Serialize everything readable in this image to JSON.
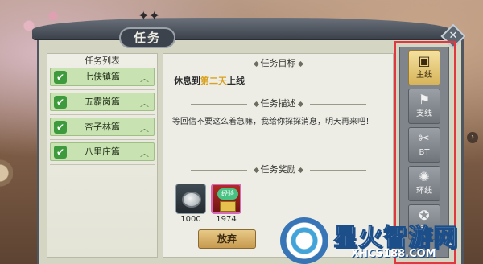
{
  "window": {
    "title": "任务",
    "close_label": "✕"
  },
  "task_list": {
    "title": "任务列表",
    "items": [
      {
        "label": "七侠镇篇",
        "checked": true
      },
      {
        "label": "五霸岗篇",
        "checked": true
      },
      {
        "label": "杏子林篇",
        "checked": true
      },
      {
        "label": "八里庄篇",
        "checked": true
      }
    ]
  },
  "detail": {
    "goal_heading": "任务目标",
    "goal_prefix": "休息到",
    "goal_highlight": "第二天",
    "goal_suffix": "上线",
    "desc_heading": "任务描述",
    "description": "等回信不要这么着急嘛，我给你探探消息，明天再来吧！",
    "reward_heading": "任务奖励",
    "rewards": [
      {
        "icon": "silver-coin-icon",
        "amount": "1000"
      },
      {
        "icon": "exp-gift-icon",
        "amount": "1974",
        "badge": "经验"
      }
    ],
    "abandon_button": "放弃"
  },
  "tabs": [
    {
      "label": "主线",
      "icon": "main-quest-icon",
      "active": true
    },
    {
      "label": "支线",
      "icon": "side-quest-icon",
      "active": false
    },
    {
      "label": "BT",
      "icon": "bt-quest-icon",
      "active": false
    },
    {
      "label": "环线",
      "icon": "loop-quest-icon",
      "active": false
    },
    {
      "label": "奇",
      "icon": "special-quest-icon",
      "active": false
    }
  ],
  "watermark": {
    "title": "星火智游网",
    "url": "XHCS188.COM"
  },
  "colors": {
    "highlight": "#d9a221",
    "active_tab": "#e4c770",
    "list_item": "#c9e2b2",
    "red_frame": "#e0383f"
  }
}
